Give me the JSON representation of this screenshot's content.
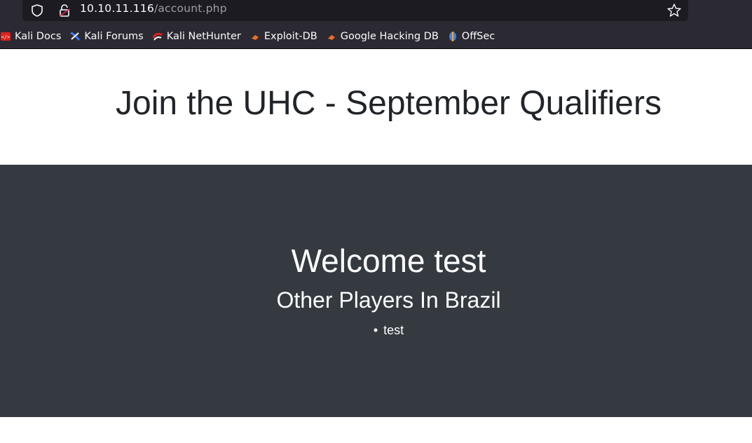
{
  "browser": {
    "url_host": "10.10.11.116",
    "url_path": "/account.php",
    "bookmarks": [
      {
        "label": "Kali Docs",
        "icon": "kali-docs-icon",
        "color": "#e0201b"
      },
      {
        "label": "Kali Forums",
        "icon": "kali-forums-icon",
        "color": "#367bf0"
      },
      {
        "label": "Kali NetHunter",
        "icon": "kali-nethunter-icon",
        "color": "#e0201b"
      },
      {
        "label": "Exploit-DB",
        "icon": "exploit-db-icon",
        "color": "#ec6d2a"
      },
      {
        "label": "Google Hacking DB",
        "icon": "ghdb-icon",
        "color": "#ec6d2a"
      },
      {
        "label": "OffSec",
        "icon": "offsec-icon",
        "color": "#3b82f6"
      }
    ]
  },
  "page": {
    "title": "Join the UHC - September Qualifiers",
    "welcome": "Welcome test",
    "subtitle": "Other Players In Brazil",
    "players": [
      "test"
    ]
  }
}
